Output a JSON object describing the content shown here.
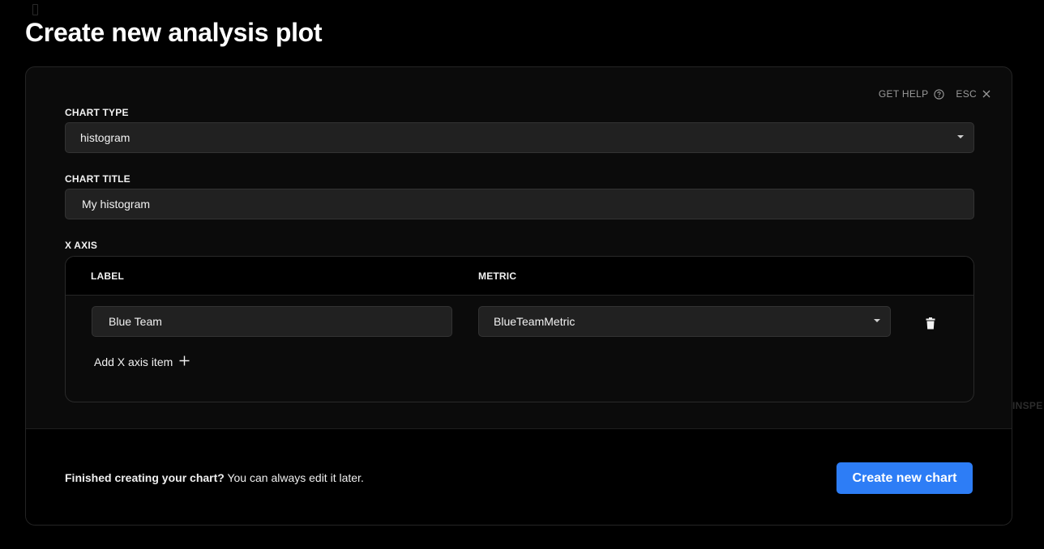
{
  "page": {
    "title": "Create new analysis plot",
    "background_label": "INSPE"
  },
  "top_actions": {
    "help_label": "GET HELP",
    "help_icon": "question-circle-icon",
    "esc_label": "ESC",
    "close_icon": "close-icon"
  },
  "chart_type": {
    "label": "CHART TYPE",
    "value": "histogram"
  },
  "chart_title": {
    "label": "CHART TITLE",
    "value": "My histogram"
  },
  "x_axis": {
    "label": "X AXIS",
    "columns": {
      "label": "LABEL",
      "metric": "METRIC"
    },
    "rows": [
      {
        "label": "Blue Team",
        "metric": "BlueTeamMetric",
        "delete_icon": "trash-icon"
      }
    ],
    "add_label": "Add X axis item",
    "add_icon": "plus-icon"
  },
  "footer": {
    "message_bold": "Finished creating your chart?",
    "message_rest": " You can always edit it later.",
    "create_button": "Create new chart"
  },
  "colors": {
    "accent": "#2d7df6",
    "background": "#000000",
    "modal": "#0b0b0b",
    "field": "#212121"
  }
}
